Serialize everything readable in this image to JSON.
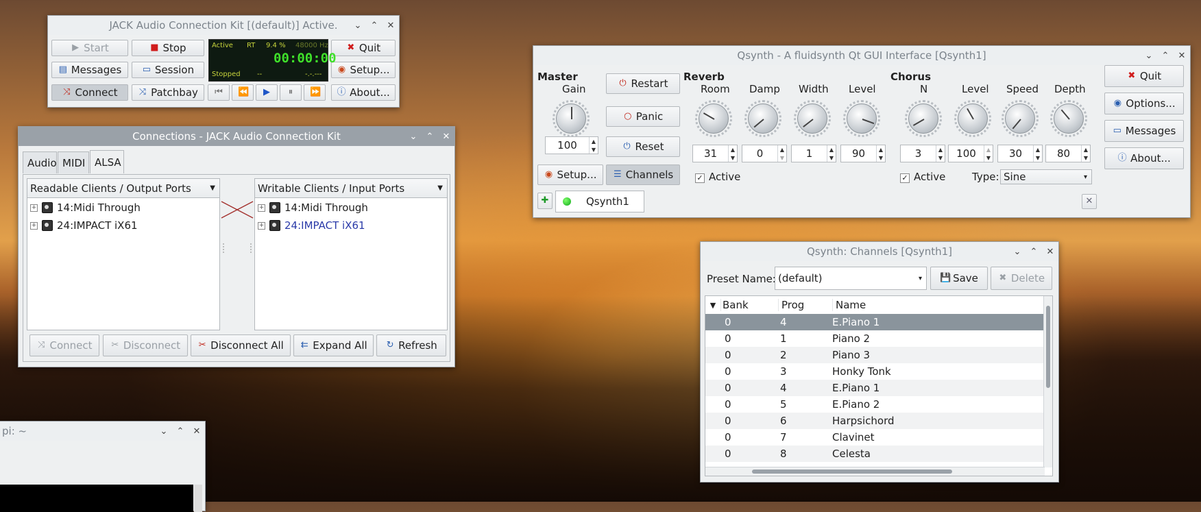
{
  "jack": {
    "title": "JACK Audio Connection Kit [(default)] Active.",
    "buttons": {
      "start": "Start",
      "stop": "Stop",
      "quit": "Quit",
      "messages": "Messages",
      "session": "Session",
      "setup": "Setup...",
      "connect": "Connect",
      "patchbay": "Patchbay",
      "about": "About..."
    },
    "display": {
      "state": "Active",
      "rt": "RT",
      "dsp": "9.4 %",
      "rate": "48000 Hz",
      "time": "00:00:00",
      "transport": "Stopped",
      "bpm": "--",
      "bbt": "-.-.---"
    }
  },
  "connections": {
    "title": "Connections - JACK Audio Connection Kit",
    "tabs": [
      "Audio",
      "MIDI",
      "ALSA"
    ],
    "readable_header": "Readable Clients / Output Ports",
    "writable_header": "Writable Clients / Input Ports",
    "readable": [
      "14:Midi Through",
      "24:IMPACT iX61"
    ],
    "writable": [
      "14:Midi Through",
      "24:IMPACT iX61"
    ],
    "buttons": {
      "connect": "Connect",
      "disconnect": "Disconnect",
      "disconnect_all": "Disconnect All",
      "expand_all": "Expand All",
      "refresh": "Refresh"
    }
  },
  "terminal": {
    "title": "pi: ~"
  },
  "qsynth": {
    "title": "Qsynth - A fluidsynth Qt GUI Interface [Qsynth1]",
    "master": {
      "heading": "Master",
      "gain_label": "Gain",
      "gain": "100"
    },
    "buttons": {
      "restart": "Restart",
      "panic": "Panic",
      "reset": "Reset",
      "setup": "Setup...",
      "channels": "Channels",
      "quit": "Quit",
      "options": "Options...",
      "messages": "Messages",
      "about": "About..."
    },
    "reverb": {
      "heading": "Reverb",
      "room_label": "Room",
      "damp_label": "Damp",
      "width_label": "Width",
      "level_label": "Level",
      "room": "31",
      "damp": "0",
      "width": "1",
      "level": "90",
      "active": "Active"
    },
    "chorus": {
      "heading": "Chorus",
      "n_label": "N",
      "level_label": "Level",
      "speed_label": "Speed",
      "depth_label": "Depth",
      "n": "3",
      "level": "100",
      "speed": "30",
      "depth": "80",
      "active": "Active",
      "type_label": "Type:",
      "type": "Sine"
    },
    "engine_tab": "Qsynth1"
  },
  "channels": {
    "title": "Qsynth: Channels [Qsynth1]",
    "preset_label": "Preset Name:",
    "preset_value": "(default)",
    "save": "Save",
    "delete": "Delete",
    "columns": [
      "Bank",
      "Prog",
      "Name"
    ],
    "rows": [
      {
        "bank": "0",
        "prog": "4",
        "name": "E.Piano 1"
      },
      {
        "bank": "0",
        "prog": "1",
        "name": "Piano 2"
      },
      {
        "bank": "0",
        "prog": "2",
        "name": "Piano 3"
      },
      {
        "bank": "0",
        "prog": "3",
        "name": "Honky Tonk"
      },
      {
        "bank": "0",
        "prog": "4",
        "name": "E.Piano 1"
      },
      {
        "bank": "0",
        "prog": "5",
        "name": "E.Piano 2"
      },
      {
        "bank": "0",
        "prog": "6",
        "name": "Harpsichord"
      },
      {
        "bank": "0",
        "prog": "7",
        "name": "Clavinet"
      },
      {
        "bank": "0",
        "prog": "8",
        "name": "Celesta"
      }
    ]
  }
}
